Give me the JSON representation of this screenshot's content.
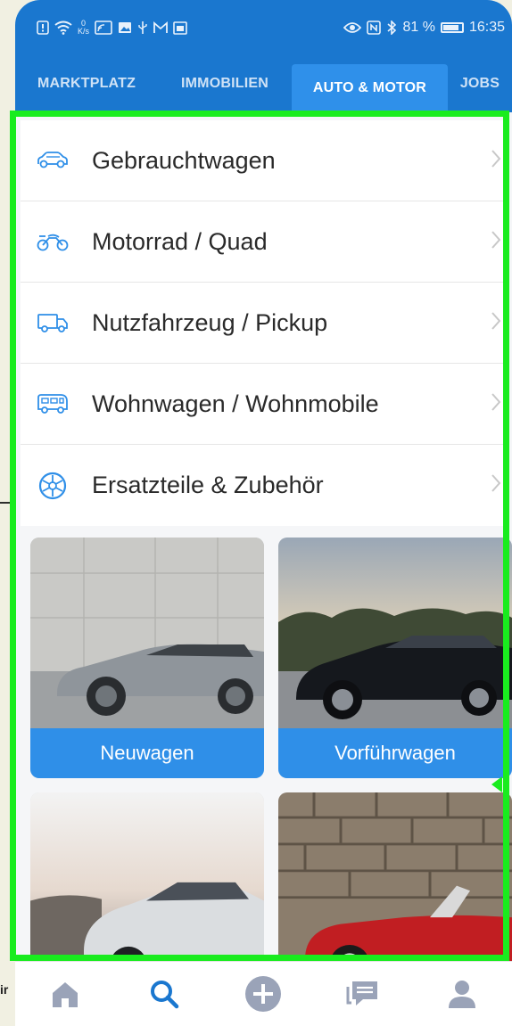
{
  "status_bar": {
    "net_speed_value": "0",
    "net_speed_unit": "K/s",
    "battery_percent": "81 %",
    "time": "16:35"
  },
  "tabs": [
    {
      "label": "MARKTPLATZ",
      "active": false
    },
    {
      "label": "IMMOBILIEN",
      "active": false
    },
    {
      "label": "AUTO & MOTOR",
      "active": true
    },
    {
      "label": "JOBS",
      "active": false
    }
  ],
  "menu": {
    "items": [
      {
        "label": "Gebrauchtwagen",
        "icon": "car-icon"
      },
      {
        "label": "Motorrad / Quad",
        "icon": "motorcycle-icon"
      },
      {
        "label": "Nutzfahrzeug / Pickup",
        "icon": "truck-icon"
      },
      {
        "label": "Wohnwagen / Wohnmobile",
        "icon": "camper-icon"
      },
      {
        "label": "Ersatzteile & Zubehör",
        "icon": "wheel-icon"
      }
    ]
  },
  "cards": [
    {
      "label": "Neuwagen"
    },
    {
      "label": "Vorführwagen"
    }
  ],
  "side_text": "ir",
  "bottom_nav": [
    "home-icon",
    "search-icon",
    "add-icon",
    "messages-icon",
    "profile-icon"
  ],
  "colors": {
    "primary": "#1a77cf",
    "active_tab": "#2f90ea",
    "caption": "#2f8fe8",
    "highlight": "#19ec1e",
    "icon": "#2f8fe8",
    "nav_inactive": "#9aa3b8"
  }
}
